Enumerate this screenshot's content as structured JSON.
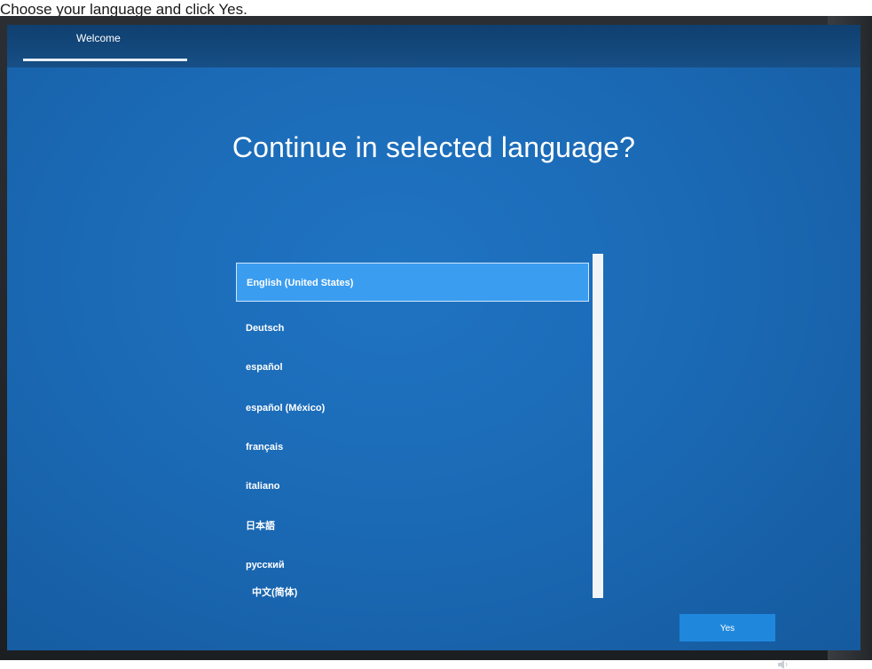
{
  "caption": "Choose your language and click Yes.",
  "header": {
    "step_label": "Welcome"
  },
  "main": {
    "title": "Continue in selected language?"
  },
  "languages": [
    "English (United States)",
    "Deutsch",
    "español",
    "español (México)",
    "français",
    "italiano",
    "日本語",
    "русский",
    "中文(简体)"
  ],
  "selected_language": "English (United States)",
  "actions": {
    "yes_label": "Yes"
  },
  "icons": {
    "tray": "volume-icon"
  },
  "colors": {
    "screen_blue": "#1b6ab6",
    "selected_item": "#3b9df0",
    "button": "#1f88dd"
  }
}
